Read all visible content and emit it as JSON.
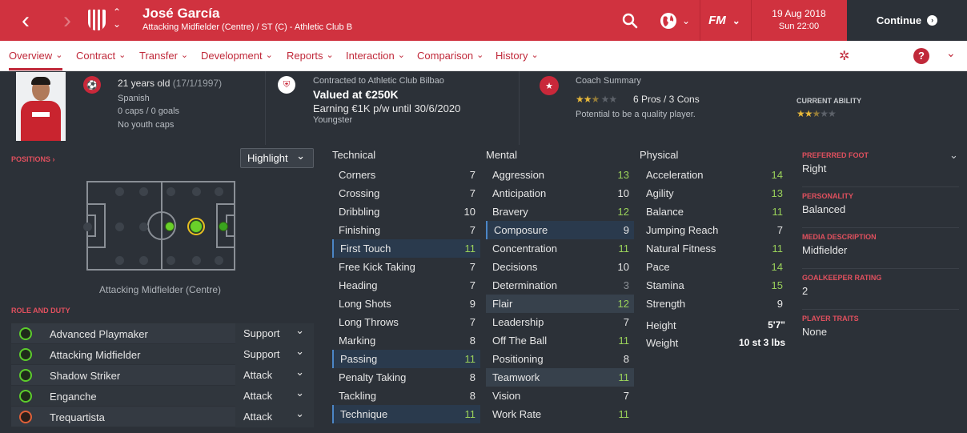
{
  "header": {
    "player_name": "José García",
    "subtitle": "Attacking Midfielder (Centre) / ST (C) - Athletic Club B",
    "date": "19 Aug 2018",
    "time": "Sun 22:00",
    "continue_label": "Continue",
    "brand": "FM"
  },
  "tabs": [
    {
      "label": "Overview"
    },
    {
      "label": "Contract"
    },
    {
      "label": "Transfer"
    },
    {
      "label": "Development"
    },
    {
      "label": "Reports"
    },
    {
      "label": "Interaction"
    },
    {
      "label": "Comparison"
    },
    {
      "label": "History"
    }
  ],
  "help_label": "?",
  "profile": {
    "age": "21 years old",
    "dob": "(17/1/1997)",
    "nationality": "Spanish",
    "caps": "0 caps / 0 goals",
    "youth_caps": "No youth caps"
  },
  "contract": {
    "contracted_to": "Contracted to Athletic Club Bilbao",
    "value": "Valued at €250K",
    "earning": "Earning €1K p/w until 30/6/2020",
    "status": "Youngster"
  },
  "coach": {
    "title": "Coach Summary",
    "stars": 2.5,
    "pros_cons": "6 Pros / 3 Cons",
    "potential": "Potential to be a quality player.",
    "current_ability_label": "CURRENT ABILITY",
    "current_ability_stars": 2.5
  },
  "positions": {
    "label": "POSITIONS",
    "highlight": "Highlight",
    "selected": "Attacking Midfielder (Centre)"
  },
  "roles": {
    "label": "ROLE AND DUTY",
    "items": [
      {
        "name": "Advanced Playmaker",
        "duty": "Support"
      },
      {
        "name": "Attacking Midfielder",
        "duty": "Support"
      },
      {
        "name": "Shadow Striker",
        "duty": "Attack"
      },
      {
        "name": "Enganche",
        "duty": "Attack"
      },
      {
        "name": "Trequartista",
        "duty": "Attack"
      }
    ]
  },
  "technical": {
    "label": "Technical",
    "items": [
      {
        "name": "Corners",
        "value": 7
      },
      {
        "name": "Crossing",
        "value": 7
      },
      {
        "name": "Dribbling",
        "value": 10
      },
      {
        "name": "Finishing",
        "value": 7
      },
      {
        "name": "First Touch",
        "value": 11
      },
      {
        "name": "Free Kick Taking",
        "value": 7
      },
      {
        "name": "Heading",
        "value": 7
      },
      {
        "name": "Long Shots",
        "value": 9
      },
      {
        "name": "Long Throws",
        "value": 7
      },
      {
        "name": "Marking",
        "value": 8
      },
      {
        "name": "Passing",
        "value": 11
      },
      {
        "name": "Penalty Taking",
        "value": 8
      },
      {
        "name": "Tackling",
        "value": 8
      },
      {
        "name": "Technique",
        "value": 11
      }
    ]
  },
  "mental": {
    "label": "Mental",
    "items": [
      {
        "name": "Aggression",
        "value": 13
      },
      {
        "name": "Anticipation",
        "value": 10
      },
      {
        "name": "Bravery",
        "value": 12
      },
      {
        "name": "Composure",
        "value": 9
      },
      {
        "name": "Concentration",
        "value": 11
      },
      {
        "name": "Decisions",
        "value": 10
      },
      {
        "name": "Determination",
        "value": 3
      },
      {
        "name": "Flair",
        "value": 12
      },
      {
        "name": "Leadership",
        "value": 7
      },
      {
        "name": "Off The Ball",
        "value": 11
      },
      {
        "name": "Positioning",
        "value": 8
      },
      {
        "name": "Teamwork",
        "value": 11
      },
      {
        "name": "Vision",
        "value": 7
      },
      {
        "name": "Work Rate",
        "value": 11
      }
    ]
  },
  "physical": {
    "label": "Physical",
    "items": [
      {
        "name": "Acceleration",
        "value": 14
      },
      {
        "name": "Agility",
        "value": 13
      },
      {
        "name": "Balance",
        "value": 11
      },
      {
        "name": "Jumping Reach",
        "value": 7
      },
      {
        "name": "Natural Fitness",
        "value": 11
      },
      {
        "name": "Pace",
        "value": 14
      },
      {
        "name": "Stamina",
        "value": 15
      },
      {
        "name": "Strength",
        "value": 9
      }
    ],
    "height_label": "Height",
    "height": "5'7\"",
    "weight_label": "Weight",
    "weight": "10 st 3 lbs"
  },
  "details": [
    {
      "key": "PREFERRED FOOT",
      "value": "Right"
    },
    {
      "key": "PERSONALITY",
      "value": "Balanced"
    },
    {
      "key": "MEDIA DESCRIPTION",
      "value": "Midfielder"
    },
    {
      "key": "GOALKEEPER RATING",
      "value": "2"
    },
    {
      "key": "PLAYER TRAITS",
      "value": "None"
    }
  ],
  "colors": {
    "accent": "#d0323f",
    "panel": "#2c3138",
    "good_value": "#9ad15a"
  }
}
